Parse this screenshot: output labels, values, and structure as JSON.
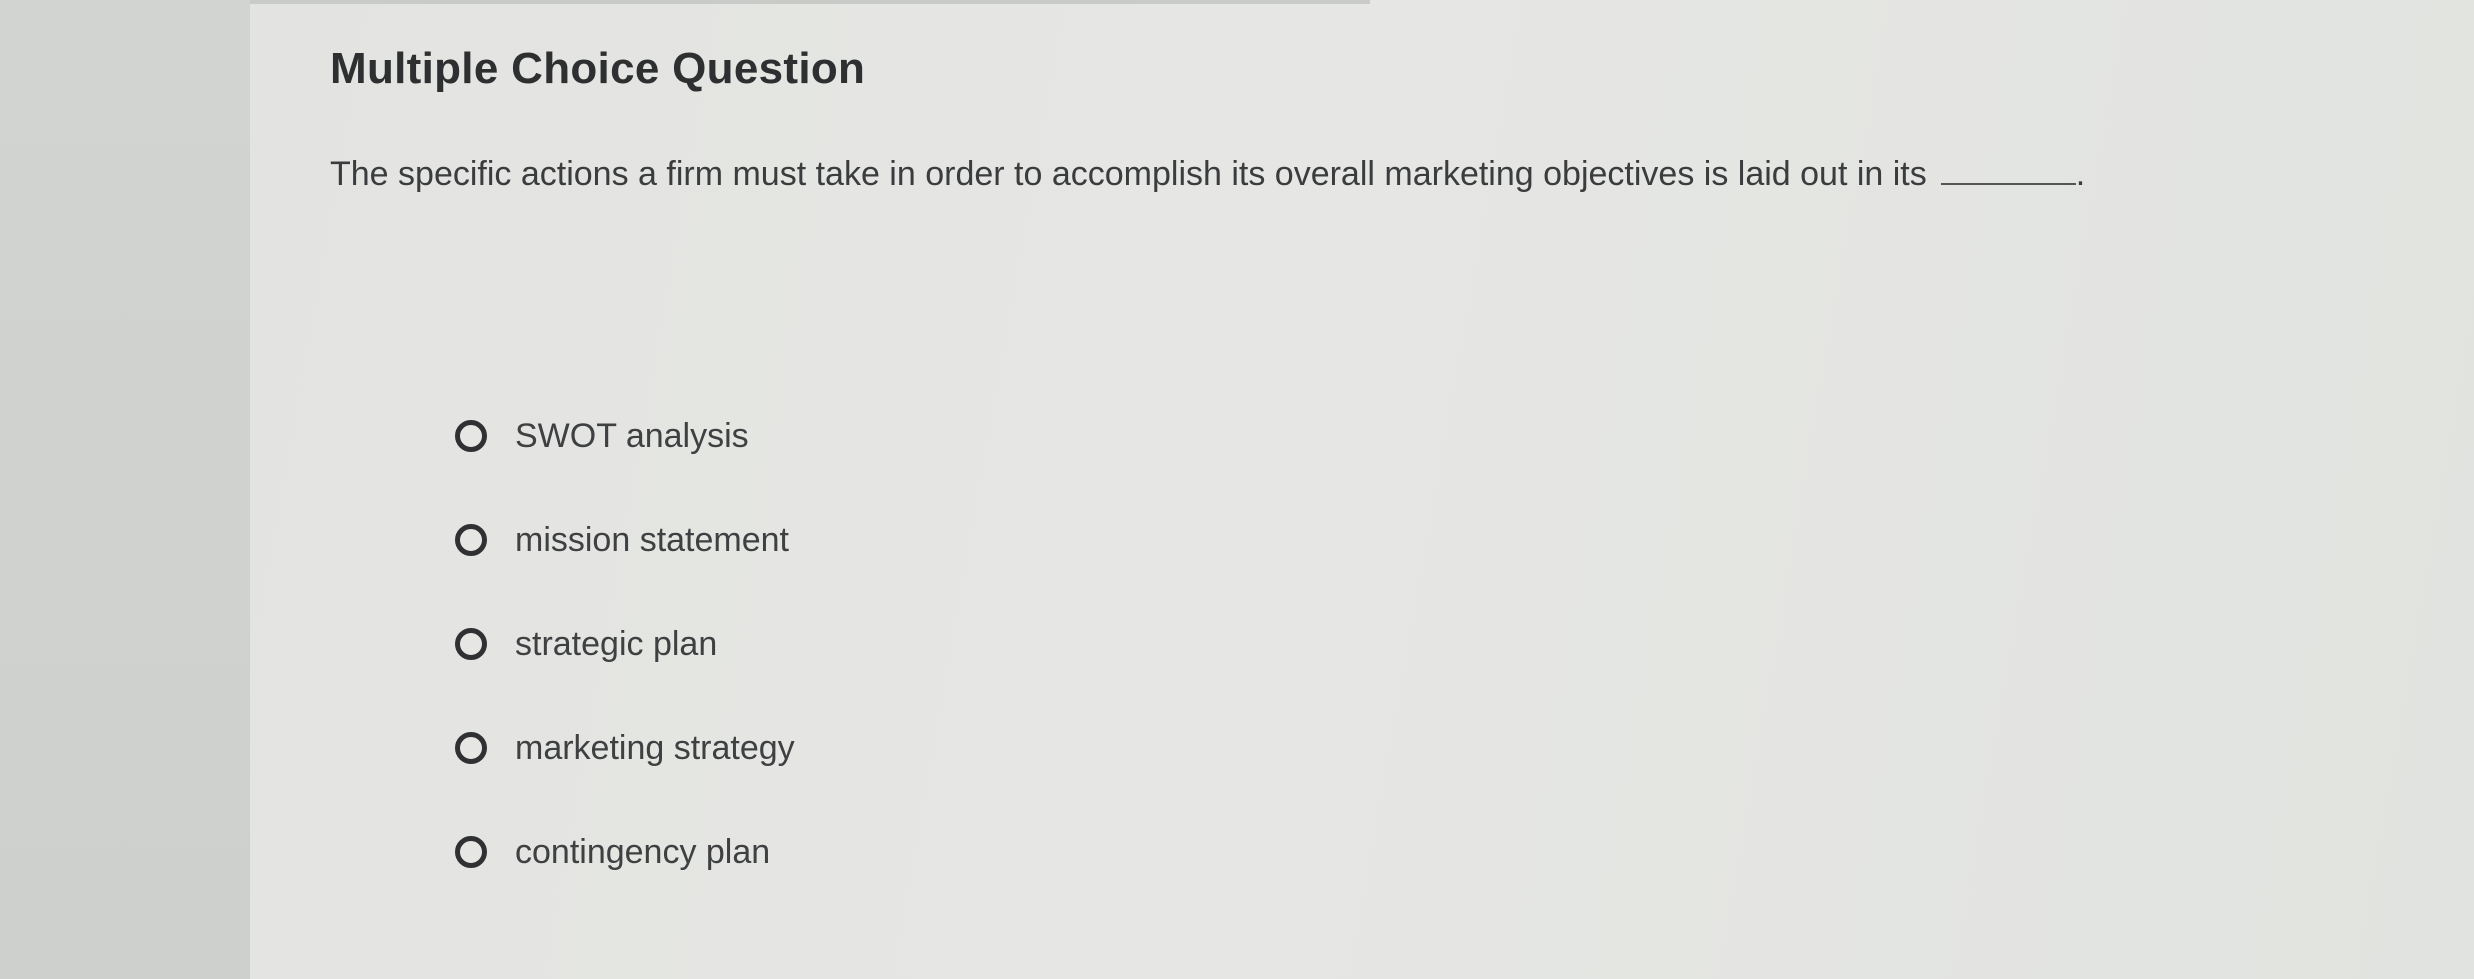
{
  "question": {
    "heading": "Multiple Choice Question",
    "text": "The specific actions a firm must take in order to accomplish its overall marketing objectives is laid out in its",
    "end_punctuation": "."
  },
  "options": [
    {
      "label": "SWOT analysis",
      "selected": false
    },
    {
      "label": "mission statement",
      "selected": false
    },
    {
      "label": "strategic plan",
      "selected": false
    },
    {
      "label": "marketing strategy",
      "selected": false
    },
    {
      "label": "contingency plan",
      "selected": false
    }
  ],
  "colors": {
    "text": "#3a3c3e",
    "heading": "#2d2f30",
    "background": "#e4e5e2"
  }
}
